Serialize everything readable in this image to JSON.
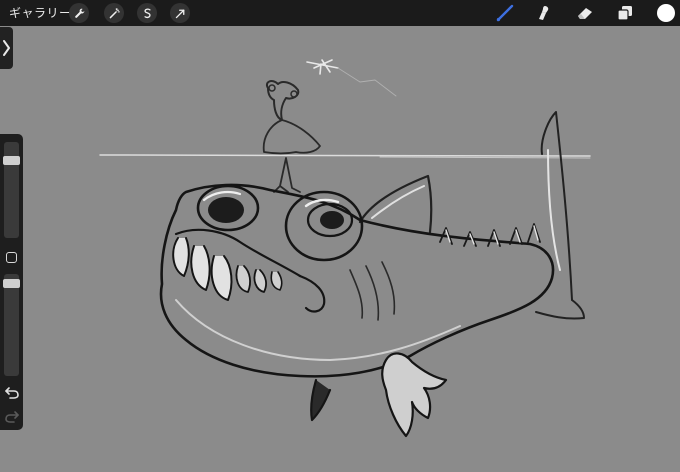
{
  "topbar": {
    "gallery_label": "ギャラリー",
    "left_tools": [
      {
        "icon": "wrench-icon"
      },
      {
        "icon": "magic-wand-icon"
      },
      {
        "icon": "selection-icon"
      },
      {
        "icon": "transform-arrow-icon"
      }
    ],
    "right_tools": [
      {
        "icon": "brush-icon",
        "active": true
      },
      {
        "icon": "smudge-icon",
        "active": false
      },
      {
        "icon": "eraser-icon",
        "active": false
      },
      {
        "icon": "layers-icon",
        "active": false
      }
    ],
    "current_color": "#ffffff"
  },
  "sidebar": {
    "brush_size": 0.78,
    "brush_opacity": 0.97,
    "accent": "#3d6fe0"
  }
}
